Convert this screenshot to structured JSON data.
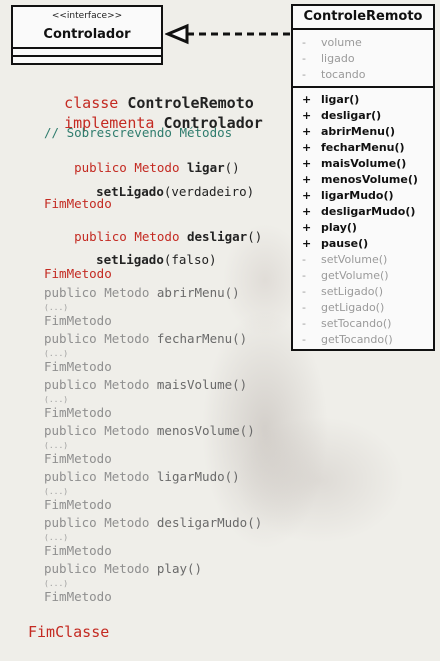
{
  "interface_box": {
    "stereotype": "<<interface>>",
    "name": "Controlador"
  },
  "class_box": {
    "name": "ControleRemoto",
    "attributes": [
      {
        "visibility": "-",
        "name": "volume"
      },
      {
        "visibility": "-",
        "name": "ligado"
      },
      {
        "visibility": "-",
        "name": "tocando"
      }
    ],
    "methods": [
      {
        "visibility": "+",
        "name": "ligar()",
        "style": "dark"
      },
      {
        "visibility": "+",
        "name": "desligar()",
        "style": "dark"
      },
      {
        "visibility": "+",
        "name": "abrirMenu()",
        "style": "dark"
      },
      {
        "visibility": "+",
        "name": "fecharMenu()",
        "style": "dark"
      },
      {
        "visibility": "+",
        "name": "maisVolume()",
        "style": "dark"
      },
      {
        "visibility": "+",
        "name": "menosVolume()",
        "style": "dark"
      },
      {
        "visibility": "+",
        "name": "ligarMudo()",
        "style": "dark"
      },
      {
        "visibility": "+",
        "name": "desligarMudo()",
        "style": "dark"
      },
      {
        "visibility": "+",
        "name": "play()",
        "style": "dark"
      },
      {
        "visibility": "+",
        "name": "pause()",
        "style": "dark"
      },
      {
        "visibility": "-",
        "name": "setVolume()",
        "style": "grey"
      },
      {
        "visibility": "-",
        "name": "getVolume()",
        "style": "grey"
      },
      {
        "visibility": "-",
        "name": "setLigado()",
        "style": "grey"
      },
      {
        "visibility": "-",
        "name": "getLigado()",
        "style": "grey"
      },
      {
        "visibility": "-",
        "name": "setTocando()",
        "style": "grey"
      },
      {
        "visibility": "-",
        "name": "getTocando()",
        "style": "grey"
      }
    ]
  },
  "code": {
    "kw_classe": "classe",
    "class_name": "ControleRemoto",
    "kw_implementa": "implementa",
    "interface_name": "Controlador",
    "comment": "// Sobrescrevendo Métodos",
    "kw_publico_metodo": "publico Metodo",
    "ligar_name": "ligar",
    "ligar_parens": "()",
    "set_ligado": "setLigado",
    "arg_true": "(verdadeiro)",
    "fim_metodo": "FimMetodo",
    "desligar_name": "desligar",
    "arg_false": "(falso)",
    "ellipsis": "(...)",
    "grey_methods": [
      "abrirMenu()",
      "fecharMenu()",
      "maisVolume()",
      "menosVolume()",
      "ligarMudo()",
      "desligarMudo()",
      "play()"
    ],
    "fim_classe": "FimClasse"
  },
  "colors": {
    "keyword_red": "#c42a22",
    "comment_teal": "#2f7c6d",
    "dim_grey": "#8f8f8f"
  }
}
